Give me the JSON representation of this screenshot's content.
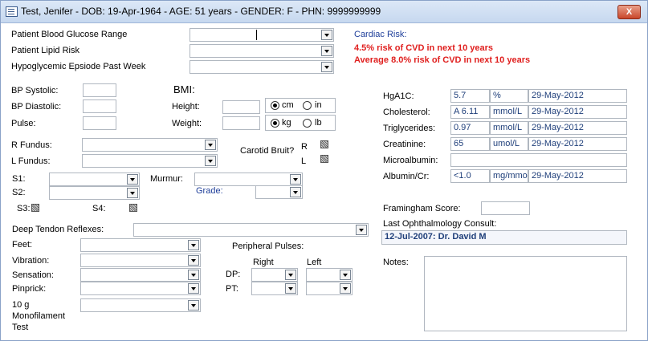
{
  "window": {
    "title": "Test, Jenifer - DOB: 19-Apr-1964 - AGE:  51 years - GENDER: F - PHN: 9999999999",
    "close_label": "X"
  },
  "risk": {
    "glucose_label": "Patient Blood Glucose Range",
    "lipid_label": "Patient Lipid Risk",
    "hypo_label": "Hypoglycemic Epsiode Past  Week"
  },
  "cardiac": {
    "title": "Cardiac Risk:",
    "line1": "4.5% risk of CVD in next 10 years",
    "line2": "Average 8.0% risk of CVD in next 10 years"
  },
  "vitals": {
    "bp_systolic": "BP Systolic:",
    "bp_diastolic": "BP Diastolic:",
    "pulse": "Pulse:",
    "bmi": "BMI:",
    "height": "Height:",
    "weight": "Weight:",
    "unit_cm": "cm",
    "unit_in": "in",
    "unit_kg": "kg",
    "unit_lb": "lb"
  },
  "exam": {
    "r_fundus": "R Fundus:",
    "l_fundus": "L Fundus:",
    "carotid": "Carotid Bruit?",
    "r": "R",
    "l": "L",
    "s1": "S1:",
    "s2": "S2:",
    "murmur": "Murmur:",
    "grade": "Grade:",
    "s3": "S3:",
    "s4": "S4:"
  },
  "labs": [
    {
      "name": "HgA1C:",
      "value": "5.7",
      "unit": "%",
      "date": "29-May-2012"
    },
    {
      "name": "Cholesterol:",
      "value": "A 6.11",
      "unit": "mmol/L",
      "date": "29-May-2012"
    },
    {
      "name": "Triglycerides:",
      "value": "0.97",
      "unit": "mmol/L",
      "date": "29-May-2012"
    },
    {
      "name": "Creatinine:",
      "value": "65",
      "unit": "umol/L",
      "date": "29-May-2012"
    },
    {
      "name": "Microalbumin:",
      "value": "",
      "unit": "",
      "date": ""
    },
    {
      "name": "Albumin/Cr:",
      "value": "<1.0",
      "unit": "mg/mmol",
      "date": "29-May-2012"
    }
  ],
  "framingham_label": "Framingham Score:",
  "ophth": {
    "label": "Last Ophthalmology Consult:",
    "value": "12-Jul-2007: Dr. David M"
  },
  "notes_label": "Notes:",
  "neuro": {
    "dtr": "Deep Tendon Reflexes:",
    "feet": "Feet:",
    "vibration": "Vibration:",
    "sensation": "Sensation:",
    "pinprick": "Pinprick:",
    "mono1": "10 g",
    "mono2": "Monofilament",
    "mono3": "Test"
  },
  "pulses": {
    "title": "Peripheral Pulses:",
    "right": "Right",
    "left": "Left",
    "dp": "DP:",
    "pt": "PT:"
  }
}
